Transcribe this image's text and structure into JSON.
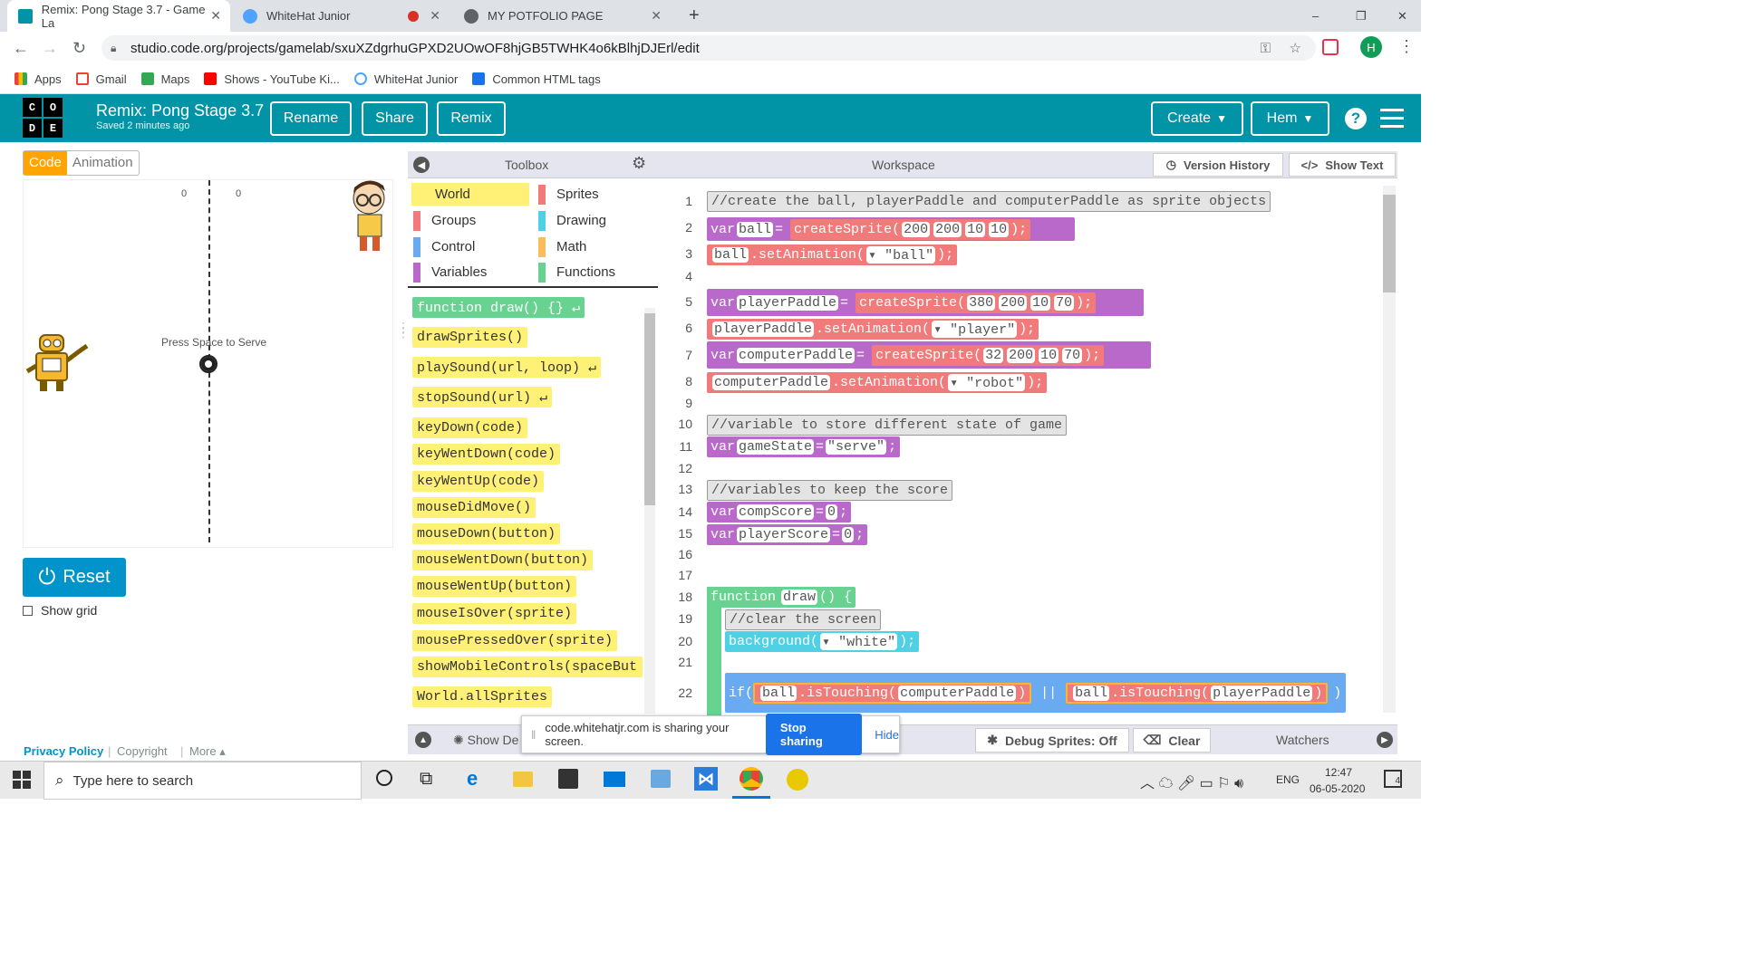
{
  "browser": {
    "tabs": [
      {
        "title": "Remix: Pong Stage 3.7 - Game La",
        "active": true
      },
      {
        "title": "WhiteHat Junior"
      },
      {
        "title": "MY POTFOLIO PAGE"
      }
    ],
    "new_tab": "+",
    "window_controls": {
      "min": "–",
      "max": "❐",
      "close": "✕"
    },
    "url": "studio.code.org/projects/gamelab/sxuXZdgrhuGPXD2UOwOF8hjGB5TWHK4o6kBlhjDJErl/edit",
    "profile_initial": "H",
    "bookmarks": [
      "Apps",
      "Gmail",
      "Maps",
      "Shows - YouTube Ki...",
      "WhiteHat Junior",
      "Common HTML tags"
    ]
  },
  "app": {
    "logo_letters": [
      "C",
      "O",
      "D",
      "E"
    ],
    "project_title": "Remix: Pong Stage 3.7",
    "saved_status": "Saved 2 minutes ago",
    "buttons": {
      "rename": "Rename",
      "share": "Share",
      "remix": "Remix",
      "create": "Create",
      "user": "Hem"
    },
    "help": "?"
  },
  "left": {
    "tabs": {
      "code": "Code",
      "animation": "Animation"
    },
    "score_left": "0",
    "score_right": "0",
    "prompt": "Press Space to Serve",
    "reset": "Reset",
    "show_grid": "Show grid",
    "footer": {
      "privacy": "Privacy Policy",
      "copyright": "Copyright",
      "more": "More ▴"
    }
  },
  "toolbox": {
    "title": "Toolbox",
    "categories": [
      {
        "name": "World",
        "color": "#fff176"
      },
      {
        "name": "Sprites",
        "color": "#f17b7b"
      },
      {
        "name": "Groups",
        "color": "#f17b7b"
      },
      {
        "name": "Drawing",
        "color": "#4fd0e5"
      },
      {
        "name": "Control",
        "color": "#6aaaf0"
      },
      {
        "name": "Math",
        "color": "#fbbd5c"
      },
      {
        "name": "Variables",
        "color": "#b869c9"
      },
      {
        "name": "Functions",
        "color": "#68d391"
      }
    ],
    "blocks": [
      "function draw() {} ↵",
      "drawSprites()",
      "playSound(url, loop) ↵",
      "stopSound(url) ↵",
      "keyDown(code)",
      "keyWentDown(code)",
      "keyWentUp(code)",
      "mouseDidMove()",
      "mouseDown(button)",
      "mouseWentDown(button)",
      "mouseWentUp(button)",
      "mouseIsOver(sprite)",
      "mousePressedOver(sprite)",
      "showMobileControls(spaceBut",
      "World.allSprites"
    ]
  },
  "workspace": {
    "title": "Workspace",
    "version_history": "Version History",
    "show_text": "Show Text",
    "line_numbers": [
      "1",
      "2",
      "3",
      "4",
      "5",
      "6",
      "7",
      "8",
      "9",
      "10",
      "11",
      "12",
      "13",
      "14",
      "15",
      "16",
      "17",
      "18",
      "19",
      "20",
      "21",
      "22"
    ],
    "code": {
      "l1": "//create the ball, playerPaddle and computerPaddle as sprite objects",
      "l2a": "var",
      "l2b": "ball",
      "l2c": "=",
      "l2d": "createSprite(",
      "l2e": "200",
      "l2f": "200",
      "l2g": "10",
      "l2h": "10",
      "l2i": ");",
      "l3a": "ball",
      ".": ".",
      "l3b": ".setAnimation(",
      "l3c": "▾ \"ball\"",
      "l3d": ");",
      "l5a": "var",
      "l5b": "playerPaddle",
      "l5c": "=",
      "l5d": "createSprite(",
      "l5e": "380",
      "l5f": "200",
      "l5g": "10",
      "l5h": "70",
      "l5i": ");",
      "l6a": "playerPaddle",
      "l6b": ".setAnimation(",
      "l6c": "▾ \"player\"",
      "l6d": ");",
      "l7a": "var",
      "l7b": "computerPaddle",
      "l7c": "=",
      "l7d": "createSprite(",
      "l7e": "32",
      "l7f": "200",
      "l7g": "10",
      "l7h": "70",
      "l7i": ");",
      "l8a": "computerPaddle",
      "l8b": ".setAnimation(",
      "l8c": "▾ \"robot\"",
      "l8d": ");",
      "l10": "//variable to store different state of game",
      "l11a": "var",
      "l11b": "gameState",
      "l11c": "=",
      "l11d": "\"serve\"",
      "l11e": ";",
      "l13": "//variables to keep the score",
      "l14a": "var",
      "l14b": "compScore",
      "l14c": "=",
      "l14d": "0",
      "l14e": ";",
      "l15a": "var",
      "l15b": "playerScore",
      "l15c": "=",
      "l15d": "0",
      "l15e": ";",
      "l18a": "function",
      "l18b": "draw",
      "l18c": "() {",
      "l19": "//clear the screen",
      "l20a": "background(",
      "l20b": "▾ \"white\"",
      "l20c": ");",
      "l22a": "if(",
      "l22b": "ball",
      "l22c": ".isTouching(",
      "l22d": "computerPaddle",
      "l22e": ")",
      "l22f": "||",
      "l22g": "ball",
      "l22h": ".isTouching(",
      "l22i": "playerPaddle",
      "l22j": ")",
      ") {": ") {"
    }
  },
  "bottom": {
    "show_debug": "Show De",
    "sharing_text": "code.whitehatjr.com is sharing your screen.",
    "stop_sharing": "Stop sharing",
    "hide": "Hide",
    "debug_sprites": "Debug Sprites: Off",
    "clear": "Clear",
    "watchers": "Watchers"
  },
  "taskbar": {
    "search": "Type here to search",
    "lang": "ENG",
    "time": "12:47",
    "date": "06-05-2020",
    "notif": "4"
  }
}
